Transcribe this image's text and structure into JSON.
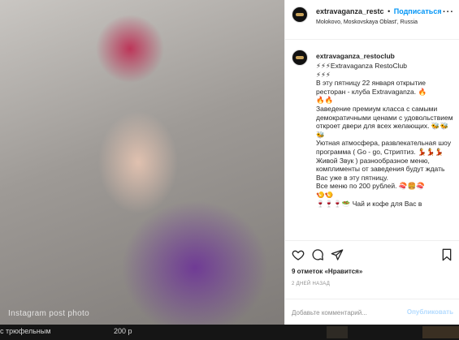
{
  "photo": {
    "alt": "Instagram post photo"
  },
  "header": {
    "username": "extravaganza_restc",
    "separator": "•",
    "follow_label": "Подписаться",
    "location": "Molokovo, Moskovskaya Oblast', Russia",
    "more_label": "···"
  },
  "caption": {
    "username": "extravaganza_restoclub",
    "body": "⚡⚡⚡Extravaganza RestoClub\n⚡⚡⚡\nВ эту пятницу 22 января открытие ресторан - клуба Extravaganza. 🔥\n🔥🔥\nЗаведение премиум класса с самыми демократичными ценами с удовольствием откроет двери для всех желающих. 🐝🐝🐝\nУютная атмосфера, развлекательная шоу программа ( Go - go, Стриптиз. 💃💃💃 Живой Звук ) разнообразное меню, комплименты от заведения будут ждать Вас уже в эту пятницу.\nВсе меню по 200 рублей. 🍣🍔🍣\n🍤🍤\n🍷🍷🍷🥗 Чай и кофе для Вас в"
  },
  "actions": {
    "like_icon": "heart-icon",
    "comment_icon": "comment-icon",
    "share_icon": "share-icon",
    "save_icon": "bookmark-icon"
  },
  "likes": {
    "count": "9 отметок",
    "suffix": "«Нравится»"
  },
  "time_ago": "2 ДНЕЙ НАЗАД",
  "comment": {
    "placeholder": "Добавьте комментарий...",
    "post_label": "Опубликовать"
  },
  "strip": {
    "text": "с трюфельным",
    "price": "200 р"
  },
  "colors": {
    "accent": "#0095f6",
    "post_disabled": "#b3dbff",
    "border": "#efefef"
  }
}
